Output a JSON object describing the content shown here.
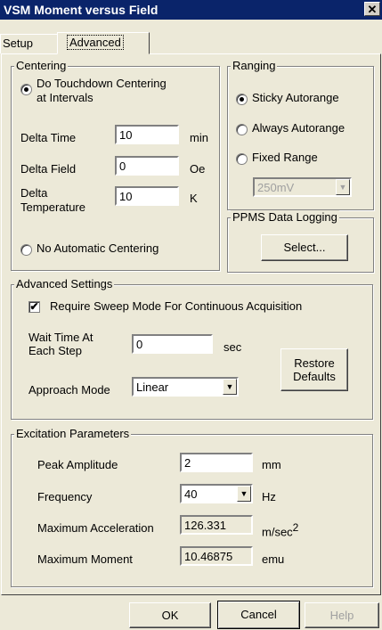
{
  "window": {
    "title": "VSM Moment versus Field",
    "close": "✕"
  },
  "tabs": [
    {
      "label": "Setup"
    },
    {
      "label": "Advanced"
    }
  ],
  "centering": {
    "group_label": "Centering",
    "touchdown_label": "Do Touchdown Centering",
    "touchdown_label2": "at Intervals",
    "delta_time_label": "Delta Time",
    "delta_time_value": "10",
    "delta_time_unit": "min",
    "delta_field_label": "Delta Field",
    "delta_field_value": "0",
    "delta_field_unit": "Oe",
    "delta_temp_label": "Delta",
    "delta_temp_label2": "Temperature",
    "delta_temp_value": "10",
    "delta_temp_unit": "K",
    "no_auto_label": "No Automatic Centering"
  },
  "ranging": {
    "group_label": "Ranging",
    "sticky_label": "Sticky Autorange",
    "always_label": "Always Autorange",
    "fixed_label": "Fixed Range",
    "fixed_value": "250mV"
  },
  "logging": {
    "group_label": "PPMS Data Logging",
    "select_label": "Select..."
  },
  "advanced": {
    "group_label": "Advanced Settings",
    "sweep_label": "Require Sweep Mode For Continuous Acquisition",
    "wait_label": "Wait Time At",
    "wait_label2": "Each Step",
    "wait_value": "0",
    "wait_unit": "sec",
    "approach_label": "Approach Mode",
    "approach_value": "Linear",
    "restore_label": "Restore",
    "restore_label2": "Defaults"
  },
  "excitation": {
    "group_label": "Excitation Parameters",
    "peak_label": "Peak Amplitude",
    "peak_value": "2",
    "peak_unit": "mm",
    "freq_label": "Frequency",
    "freq_value": "40",
    "freq_unit": "Hz",
    "accel_label": "Maximum Acceleration",
    "accel_value": "126.331",
    "accel_unit": "m/sec",
    "accel_unit_sup": "2",
    "moment_label": "Maximum Moment",
    "moment_value": "10.46875",
    "moment_unit": "emu"
  },
  "buttons": {
    "ok": "OK",
    "cancel": "Cancel",
    "help": "Help"
  },
  "icons": {
    "dropdown_arrow": "▼",
    "checkmark": "✔"
  }
}
